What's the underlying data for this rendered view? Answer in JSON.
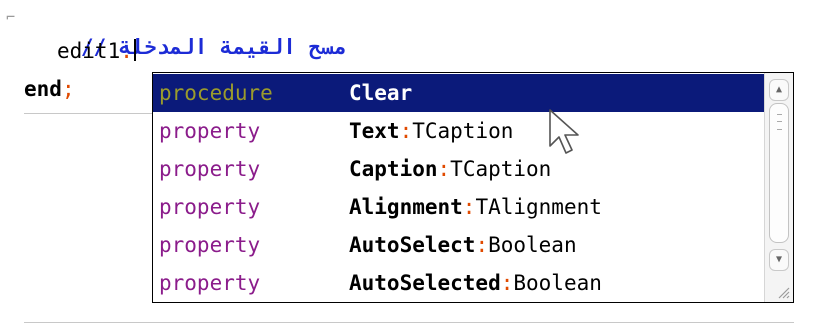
{
  "editor": {
    "comment_line": "مسح القيمة المدخلة //",
    "code_object": "edit1",
    "code_dot": ".",
    "end_keyword": "end",
    "end_semicolon": ";"
  },
  "completion": {
    "items": [
      {
        "kind": "procedure",
        "name": "Clear",
        "colon": "",
        "type": ""
      },
      {
        "kind": "property",
        "name": "Text",
        "colon": ":",
        "type": "TCaption"
      },
      {
        "kind": "property",
        "name": "Caption",
        "colon": ":",
        "type": "TCaption"
      },
      {
        "kind": "property",
        "name": "Alignment",
        "colon": ":",
        "type": "TAlignment"
      },
      {
        "kind": "property",
        "name": "AutoSelect",
        "colon": ":",
        "type": "Boolean"
      },
      {
        "kind": "property",
        "name": "AutoSelected",
        "colon": ":",
        "type": "Boolean"
      }
    ],
    "selected_index": 0,
    "colors": {
      "selection_bg": "#0b1a7a",
      "selected_kind": "#9b9b2c",
      "kind": "#8b1c8b",
      "colon": "#e04a00"
    }
  },
  "icons": {
    "fold": "fold-marker-icon",
    "scroll_up": "chevron-up-icon",
    "scroll_down": "chevron-down-icon",
    "resize": "resize-grip-icon",
    "pointer": "mouse-pointer-icon"
  }
}
